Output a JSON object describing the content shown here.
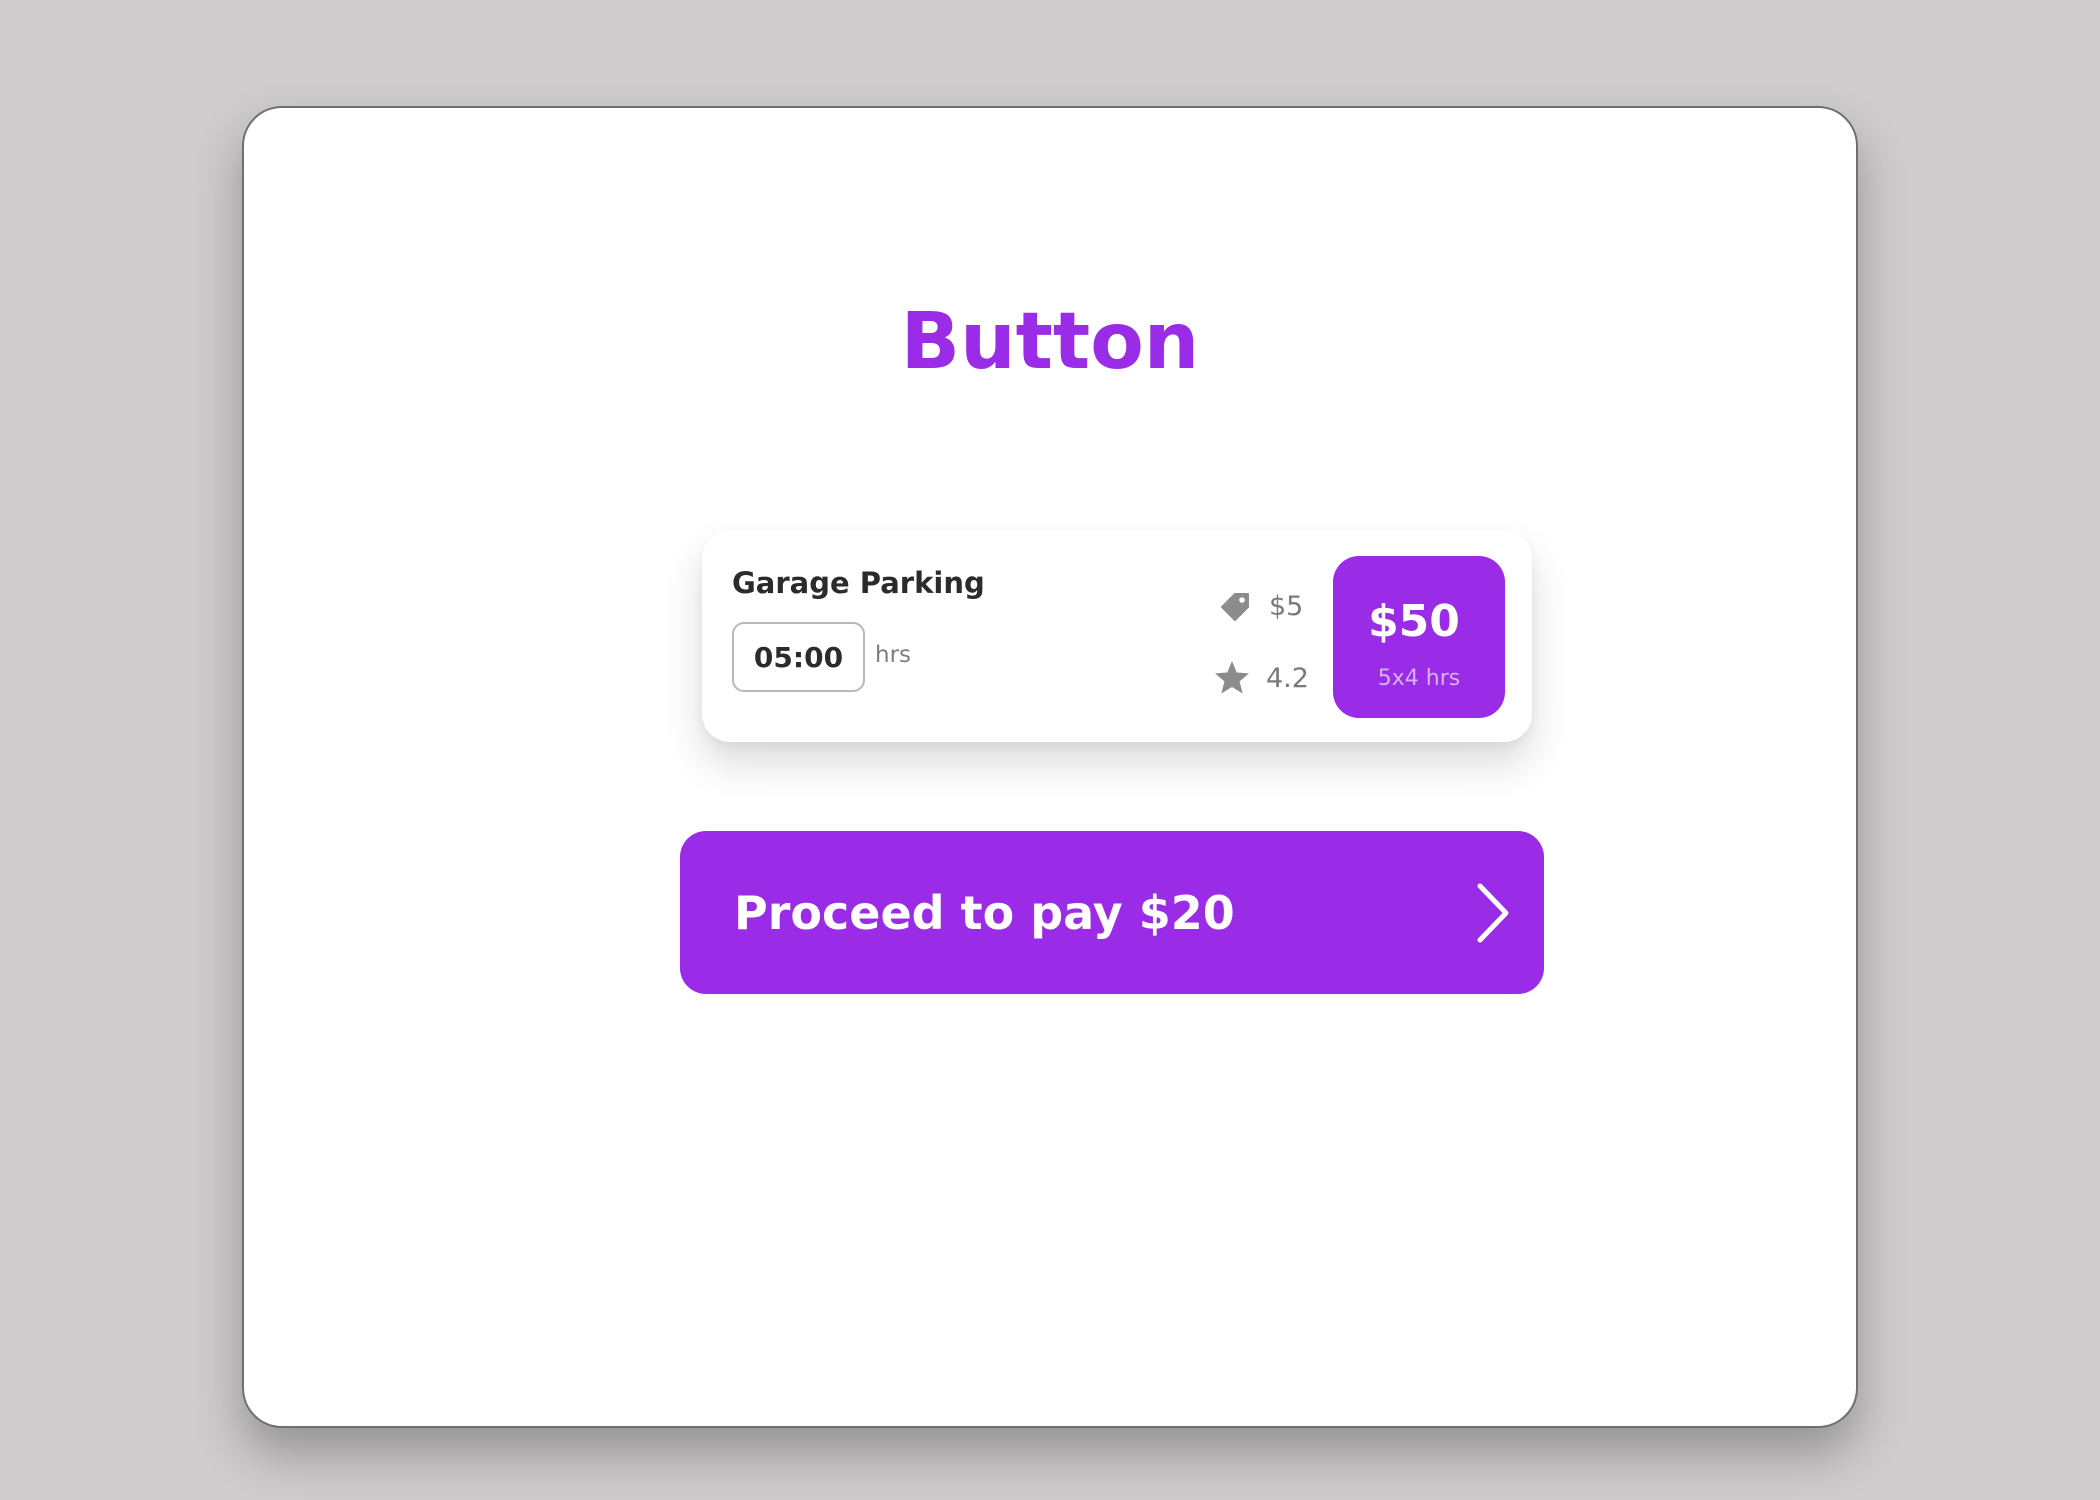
{
  "page": {
    "heading": "Button"
  },
  "parking_card": {
    "title": "Garage Parking",
    "hours_value": "05:00",
    "hours_unit": "hrs",
    "price_per_hour": "$5",
    "rating": "4.2",
    "total_amount": "$50",
    "total_breakdown": "5x4 hrs"
  },
  "pay_button": {
    "label": "Proceed to pay $20"
  },
  "icons": {
    "price": "price-tag-icon",
    "rating": "star-icon",
    "proceed": "chevron-right-icon"
  },
  "colors": {
    "accent": "#9a2be6",
    "background": "#cecccd"
  }
}
